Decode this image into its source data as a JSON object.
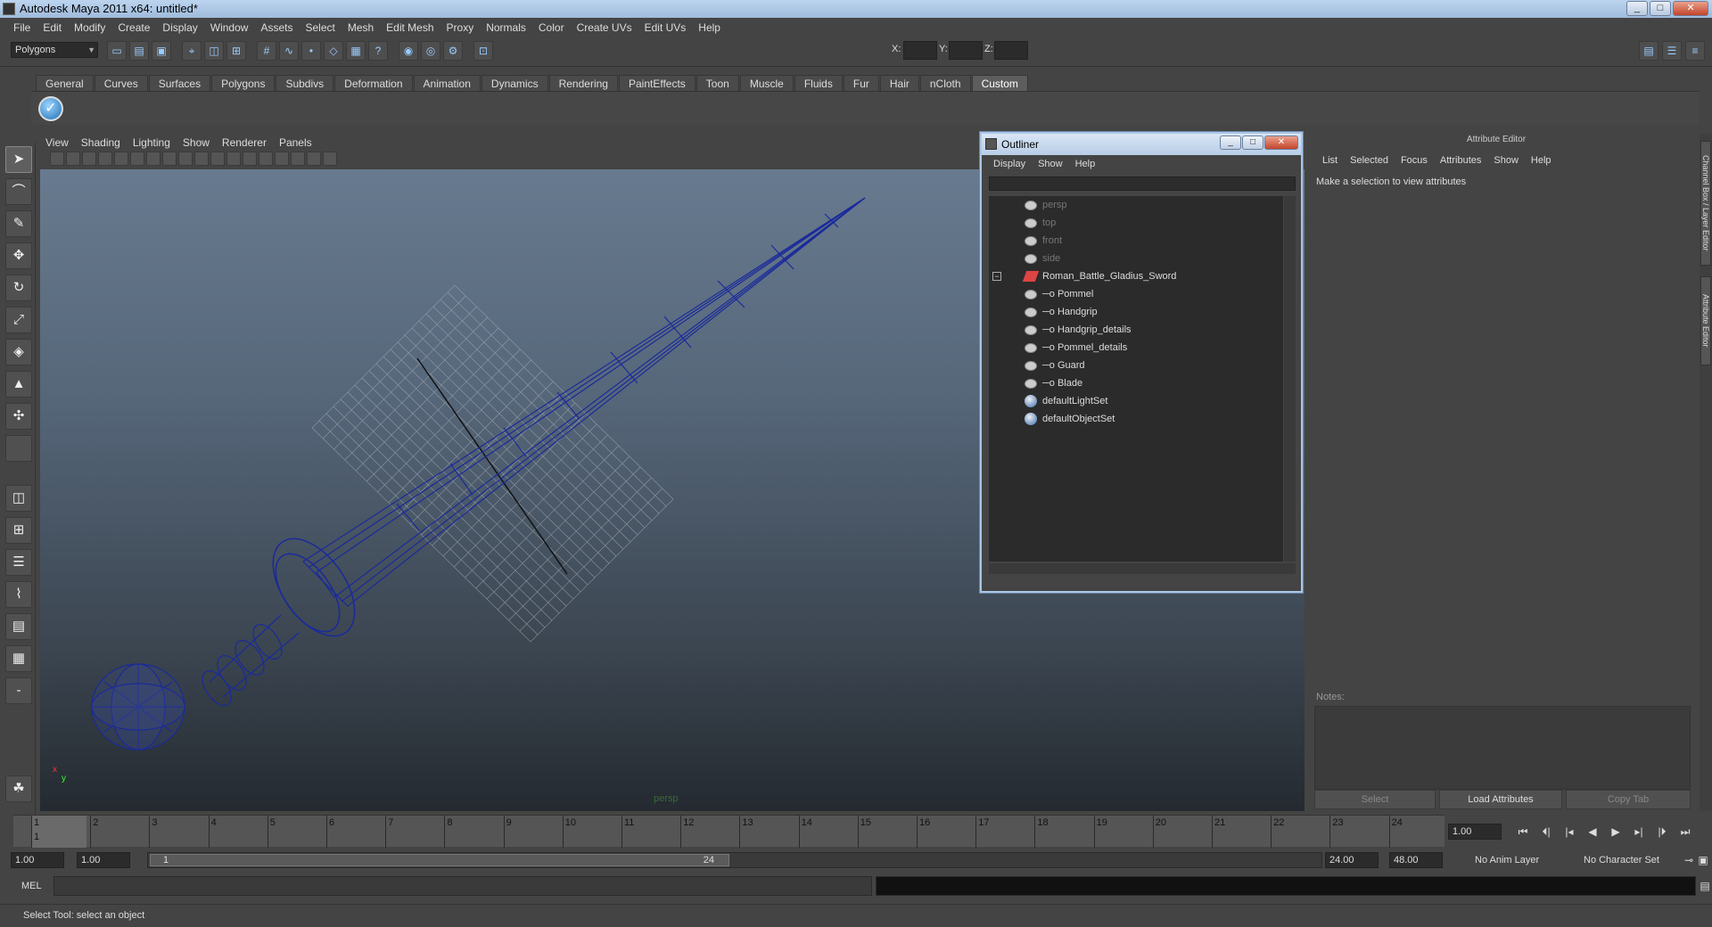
{
  "window": {
    "title": "Autodesk Maya 2011 x64: untitled*"
  },
  "menubar": [
    "File",
    "Edit",
    "Modify",
    "Create",
    "Display",
    "Window",
    "Assets",
    "Select",
    "Mesh",
    "Edit Mesh",
    "Proxy",
    "Normals",
    "Color",
    "Create UVs",
    "Edit UVs",
    "Help"
  ],
  "toolbar": {
    "mode": "Polygons",
    "x_label": "X:",
    "y_label": "Y:",
    "z_label": "Z:"
  },
  "shelf_tabs": [
    "General",
    "Curves",
    "Surfaces",
    "Polygons",
    "Subdivs",
    "Deformation",
    "Animation",
    "Dynamics",
    "Rendering",
    "PaintEffects",
    "Toon",
    "Muscle",
    "Fluids",
    "Fur",
    "Hair",
    "nCloth",
    "Custom"
  ],
  "active_shelf": "Custom",
  "viewport": {
    "menu": [
      "View",
      "Shading",
      "Lighting",
      "Show",
      "Renderer",
      "Panels"
    ],
    "camera_label": "persp",
    "axis_x": "x",
    "axis_y": "y"
  },
  "outliner": {
    "title": "Outliner",
    "menu": [
      "Display",
      "Show",
      "Help"
    ],
    "items": [
      {
        "label": "persp",
        "dim": true,
        "icon": "camera-icon"
      },
      {
        "label": "top",
        "dim": true,
        "icon": "camera-icon"
      },
      {
        "label": "front",
        "dim": true,
        "icon": "camera-icon"
      },
      {
        "label": "side",
        "dim": true,
        "icon": "camera-icon"
      },
      {
        "label": "Roman_Battle_Gladius_Sword",
        "dim": false,
        "icon": "group-icon"
      },
      {
        "label": "Pommel",
        "dim": false,
        "icon": "mesh-icon"
      },
      {
        "label": "Handgrip",
        "dim": false,
        "icon": "mesh-icon"
      },
      {
        "label": "Handgrip_details",
        "dim": false,
        "icon": "mesh-icon"
      },
      {
        "label": "Pommel_details",
        "dim": false,
        "icon": "mesh-icon"
      },
      {
        "label": "Guard",
        "dim": false,
        "icon": "mesh-icon"
      },
      {
        "label": "Blade",
        "dim": false,
        "icon": "mesh-icon"
      },
      {
        "label": "defaultLightSet",
        "dim": false,
        "icon": "set-icon"
      },
      {
        "label": "defaultObjectSet",
        "dim": false,
        "icon": "set-icon"
      }
    ]
  },
  "attribute_editor": {
    "title": "Attribute Editor",
    "menu": [
      "List",
      "Selected",
      "Focus",
      "Attributes",
      "Show",
      "Help"
    ],
    "message": "Make a selection to view attributes",
    "notes_label": "Notes:",
    "buttons": {
      "select": "Select",
      "load": "Load Attributes",
      "copy": "Copy Tab"
    }
  },
  "side_tabs": [
    "Channel Box / Layer Editor",
    "Attribute Editor"
  ],
  "timeline": {
    "frames": [
      "1",
      "2",
      "3",
      "4",
      "5",
      "6",
      "7",
      "8",
      "9",
      "10",
      "11",
      "12",
      "13",
      "14",
      "15",
      "16",
      "17",
      "18",
      "19",
      "20",
      "21",
      "22",
      "23",
      "24"
    ],
    "current_frame": "1",
    "current_time": "1.00"
  },
  "range": {
    "start_time": "1.00",
    "playback_start": "1.00",
    "slider_start": "1",
    "slider_end": "24",
    "playback_end": "24.00",
    "end_time": "48.00",
    "anim_layer": "No Anim Layer",
    "character_set": "No Character Set"
  },
  "command_line": {
    "label": "MEL"
  },
  "help_line": "Select Tool: select an object"
}
